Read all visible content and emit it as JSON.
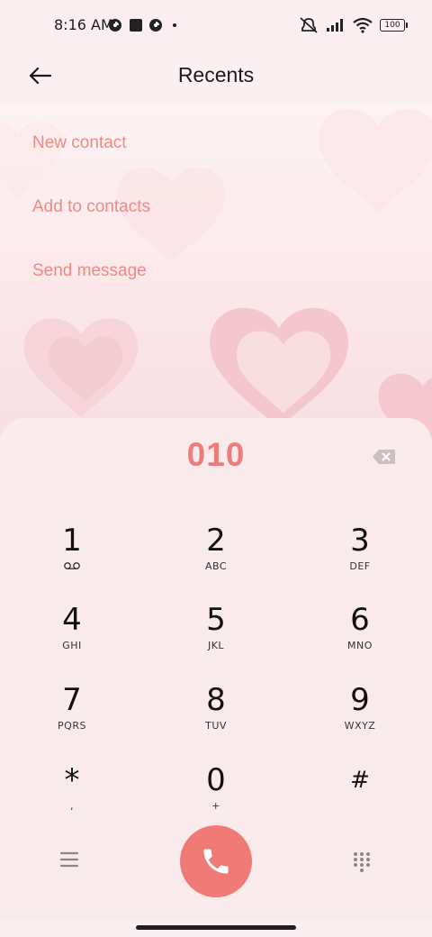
{
  "status_bar": {
    "time": "8:16 AM",
    "battery": "100",
    "icons": [
      "notification-app-icon",
      "notification-square-icon",
      "notification-app-icon-2",
      "dot-icon",
      "mute-icon",
      "signal-icon",
      "wifi-icon",
      "battery-icon"
    ]
  },
  "header": {
    "title": "Recents",
    "back_icon": "arrow-left-icon"
  },
  "actions": [
    {
      "label": "New contact"
    },
    {
      "label": "Add to contacts"
    },
    {
      "label": "Send message"
    }
  ],
  "dialer": {
    "number": "010",
    "keys": [
      {
        "digit": "1",
        "letters": ""
      },
      {
        "digit": "2",
        "letters": "ABC"
      },
      {
        "digit": "3",
        "letters": "DEF"
      },
      {
        "digit": "4",
        "letters": "GHI"
      },
      {
        "digit": "5",
        "letters": "JKL"
      },
      {
        "digit": "6",
        "letters": "MNO"
      },
      {
        "digit": "7",
        "letters": "PQRS"
      },
      {
        "digit": "8",
        "letters": "TUV"
      },
      {
        "digit": "9",
        "letters": "WXYZ"
      },
      {
        "digit": "*",
        "letters": ","
      },
      {
        "digit": "0",
        "letters": "+"
      },
      {
        "digit": "#",
        "letters": ""
      }
    ]
  },
  "colors": {
    "accent": "#ee8a84",
    "call_button": "#f07a76",
    "panel": "#f9ebec"
  }
}
